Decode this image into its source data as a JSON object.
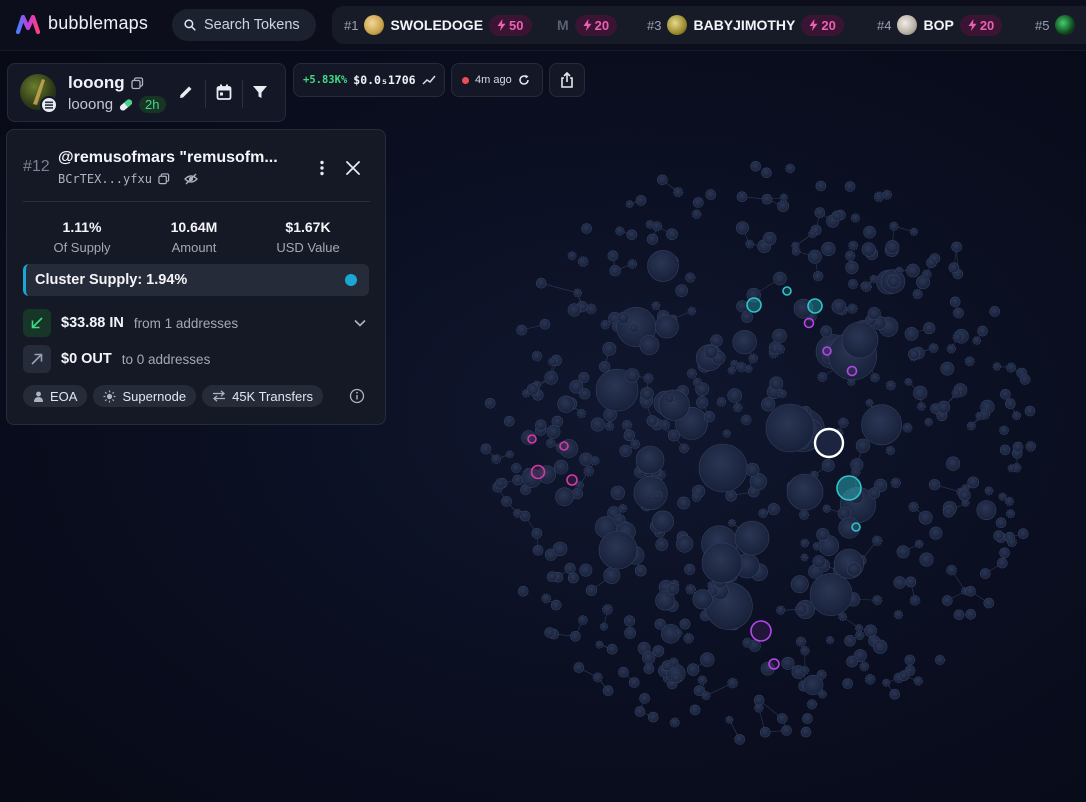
{
  "app": {
    "name": "bubblemaps"
  },
  "search": {
    "placeholder": "Search Tokens"
  },
  "trending": [
    {
      "rank": "#1",
      "name": "SWOLEDOGE",
      "boost": "50",
      "coin_color": "#c9a24a"
    },
    {
      "rank": "",
      "name": "M",
      "boost": "20",
      "coin_color": ""
    },
    {
      "rank": "#3",
      "name": "BABYJIMOTHY",
      "boost": "20",
      "coin_color": "#b6a23e"
    },
    {
      "rank": "#4",
      "name": "BOP",
      "boost": "20",
      "coin_color": "#b7b0a4"
    },
    {
      "rank": "#5",
      "name": "",
      "boost": "",
      "coin_color": "#1b8a3a"
    }
  ],
  "token": {
    "name": "looong",
    "symbol": "looong",
    "age": "2h",
    "price_change": "+5.83K%",
    "price": "$0.0₅1706",
    "updated": "4m ago"
  },
  "detail": {
    "rank": "#12",
    "title": "@remusofmars \"remusofm...",
    "address": "BCrTEX...yfxu",
    "stats": [
      {
        "value": "1.11%",
        "label": "Of Supply"
      },
      {
        "value": "10.64M",
        "label": "Amount"
      },
      {
        "value": "$1.67K",
        "label": "USD Value"
      }
    ],
    "cluster_supply": "Cluster Supply: 1.94%",
    "inflow": {
      "amount": "$33.88 IN",
      "sub": "from 1 addresses"
    },
    "outflow": {
      "amount": "$0 OUT",
      "sub": "to 0 addresses"
    },
    "tags": [
      "EOA",
      "Supernode",
      "45K Transfers"
    ]
  },
  "colors": {
    "accent_cyan": "#1aa7d6",
    "accent_pink": "#ee5fb2",
    "accent_green": "#3ddc84",
    "cluster_teal": "#2ec4c9",
    "cluster_magenta": "#d43aa6",
    "cluster_purple": "#b745e8",
    "bubble_base": "#1e2944"
  },
  "icons": [
    "bubblemaps-logo-icon",
    "search-icon",
    "bolt-icon",
    "copy-icon",
    "pill-icon",
    "edit-icon",
    "calendar-icon",
    "filter-icon",
    "trend-chart-icon",
    "refresh-icon",
    "share-icon",
    "more-vertical-icon",
    "close-icon",
    "hide-icon",
    "arrow-in-icon",
    "arrow-out-icon",
    "chevron-down-icon",
    "user-icon",
    "supernode-icon",
    "transfer-icon",
    "info-icon"
  ]
}
